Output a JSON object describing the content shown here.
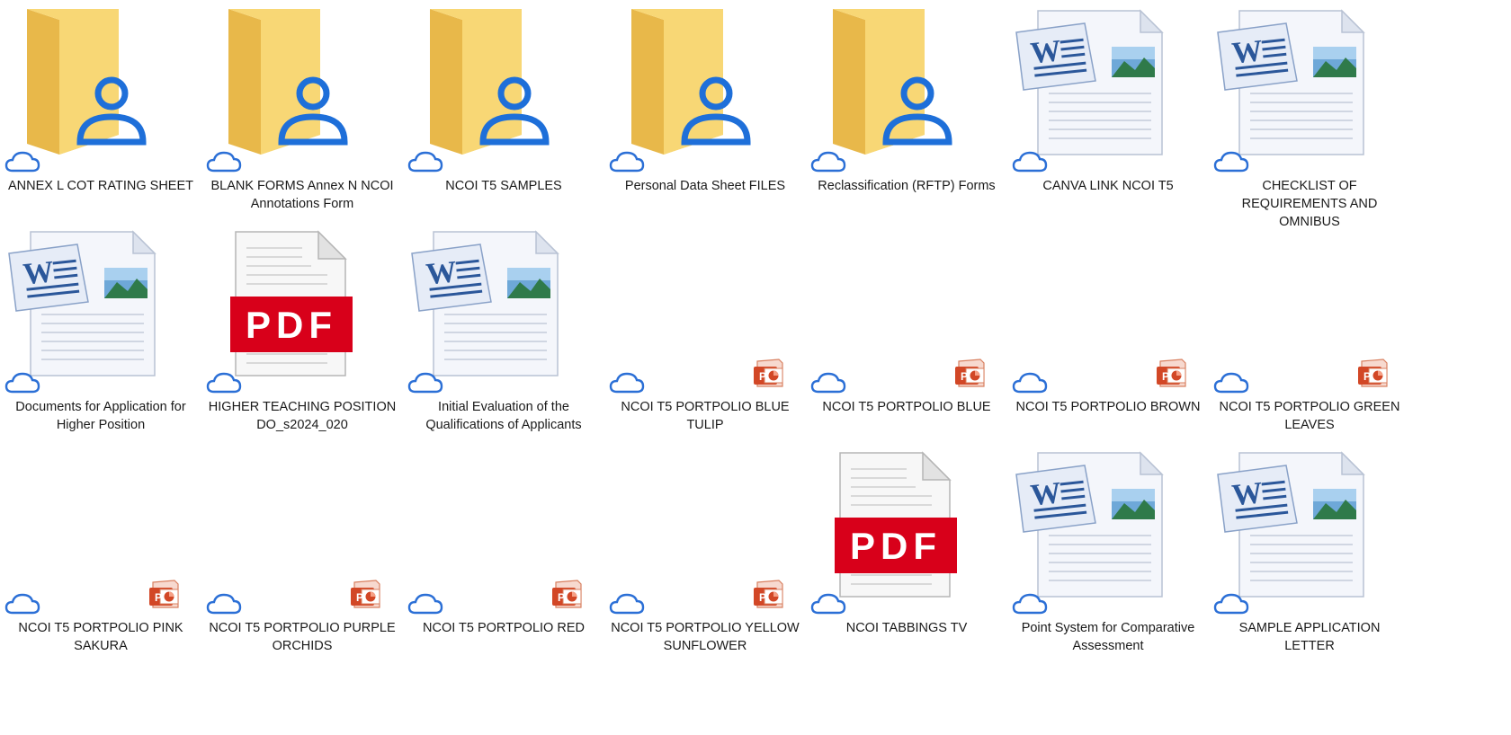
{
  "explorer": {
    "view": "large-icons",
    "items": [
      {
        "label": "ANNEX L COT RATING SHEET",
        "type": "shared-folder",
        "status_icon": "cloud-icon"
      },
      {
        "label": "BLANK FORMS Annex N NCOI Annotations Form",
        "type": "shared-folder",
        "status_icon": "cloud-icon"
      },
      {
        "label": "NCOI T5 SAMPLES",
        "type": "shared-folder",
        "status_icon": "cloud-icon"
      },
      {
        "label": "Personal Data Sheet FILES",
        "type": "shared-folder",
        "status_icon": "cloud-icon"
      },
      {
        "label": "Reclassification (RFTP) Forms",
        "type": "shared-folder",
        "status_icon": "cloud-icon"
      },
      {
        "label": "CANVA LINK NCOI T5",
        "type": "word",
        "status_icon": "cloud-icon"
      },
      {
        "label": "CHECKLIST OF REQUIREMENTS AND OMNIBUS",
        "type": "word",
        "status_icon": "cloud-icon"
      },
      {
        "label": "Documents for Application for Higher Position",
        "type": "word",
        "status_icon": "cloud-icon"
      },
      {
        "label": "HIGHER TEACHING POSITION DO_s2024_020",
        "type": "pdf",
        "status_icon": "cloud-icon"
      },
      {
        "label": "Initial Evaluation of the Qualifications of Applicants",
        "type": "word",
        "status_icon": "cloud-icon"
      },
      {
        "label": "NCOI T5 PORTPOLIO BLUE TULIP",
        "type": "powerpoint",
        "status_icon": "cloud-icon"
      },
      {
        "label": "NCOI T5 PORTPOLIO BLUE",
        "type": "powerpoint",
        "status_icon": "cloud-icon"
      },
      {
        "label": "NCOI T5 PORTPOLIO BROWN",
        "type": "powerpoint",
        "status_icon": "cloud-icon"
      },
      {
        "label": "NCOI T5 PORTPOLIO GREEN LEAVES",
        "type": "powerpoint",
        "status_icon": "cloud-icon"
      },
      {
        "label": "NCOI T5 PORTPOLIO PINK SAKURA",
        "type": "powerpoint",
        "status_icon": "cloud-icon"
      },
      {
        "label": "NCOI T5 PORTPOLIO PURPLE ORCHIDS",
        "type": "powerpoint",
        "status_icon": "cloud-icon"
      },
      {
        "label": "NCOI T5 PORTPOLIO RED",
        "type": "powerpoint",
        "status_icon": "cloud-icon"
      },
      {
        "label": "NCOI T5 PORTPOLIO YELLOW SUNFLOWER",
        "type": "powerpoint",
        "status_icon": "cloud-icon"
      },
      {
        "label": "NCOI TABBINGS TV",
        "type": "pdf",
        "status_icon": "cloud-icon"
      },
      {
        "label": "Point System for Comparative Assessment",
        "type": "word",
        "status_icon": "cloud-icon"
      },
      {
        "label": "SAMPLE APPLICATION LETTER",
        "type": "word",
        "status_icon": "cloud-icon"
      }
    ],
    "pdf_badge_text": "PDF",
    "colors": {
      "folder_back": "#e8b84a",
      "folder_front": "#f8d775",
      "shared_user": "#1e6fd9",
      "cloud_outline": "#2b6fd6",
      "pdf_red": "#d8001a",
      "word_blue": "#2b579a",
      "ppt_orange": "#d24726"
    }
  }
}
